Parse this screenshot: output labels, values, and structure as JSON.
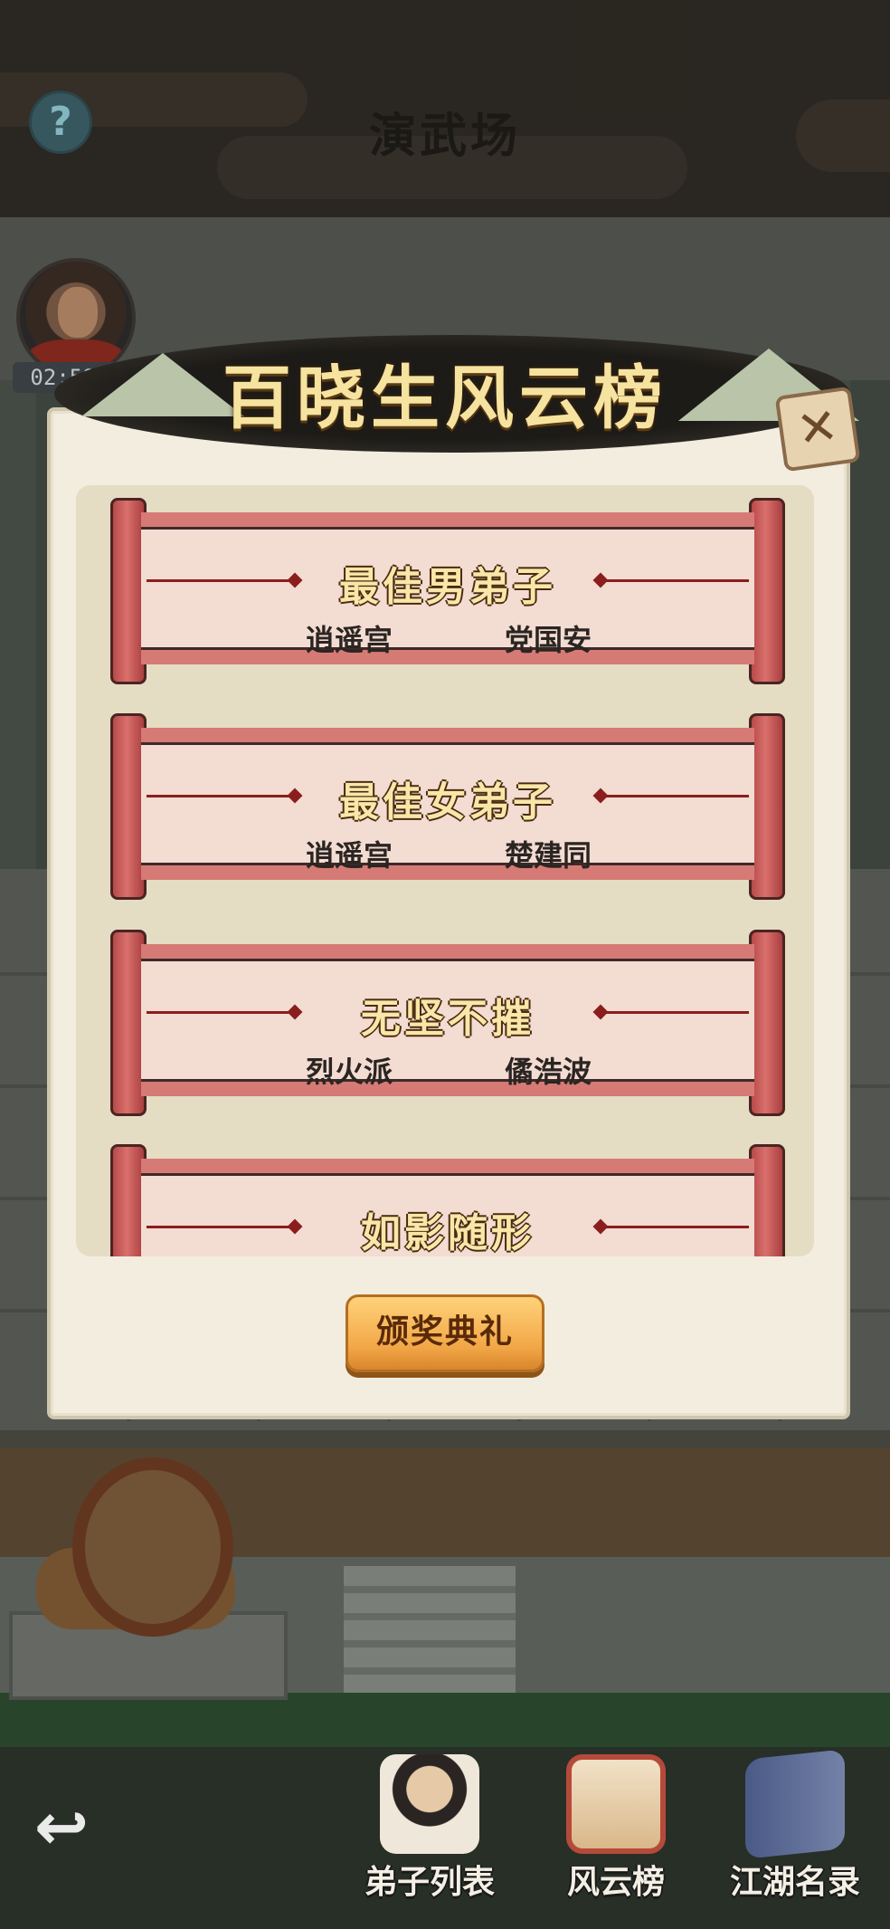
{
  "header": {
    "title": "演武场",
    "help_icon": "?"
  },
  "player": {
    "timer": "02:59:1"
  },
  "dialog": {
    "title": "百晓生风云榜",
    "close_icon": "✕",
    "awards": [
      {
        "title": "最佳男弟子",
        "sect": "逍遥宫",
        "name": "党国安"
      },
      {
        "title": "最佳女弟子",
        "sect": "逍遥宫",
        "name": "楚建同"
      },
      {
        "title": "无坚不摧",
        "sect": "烈火派",
        "name": "僪浩波"
      },
      {
        "title": "如影随形",
        "sect": "",
        "name": ""
      }
    ],
    "ceremony_button": "颁奖典礼"
  },
  "bottom_nav": {
    "back_icon": "↩",
    "items": [
      {
        "label": "弟子列表",
        "icon": "disciple-icon"
      },
      {
        "label": "风云榜",
        "icon": "ranking-scroll-icon"
      },
      {
        "label": "江湖名录",
        "icon": "roster-book-icon"
      }
    ]
  }
}
